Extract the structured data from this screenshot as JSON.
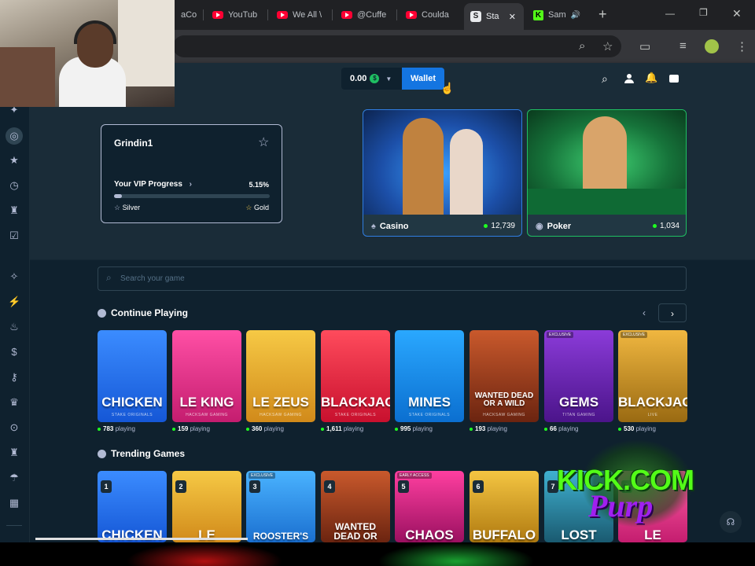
{
  "browser": {
    "tabs": [
      {
        "label": "aCo",
        "type": "plain"
      },
      {
        "label": "YouTub",
        "type": "youtube"
      },
      {
        "label": "We All \\",
        "type": "youtube"
      },
      {
        "label": "@Cuffe",
        "type": "youtube"
      },
      {
        "label": "Coulda",
        "type": "youtube"
      },
      {
        "label": "Sta",
        "type": "stake",
        "active": true
      },
      {
        "label": "Sam",
        "type": "kick"
      }
    ],
    "close_glyph": "✕",
    "new_tab_glyph": "+",
    "min_glyph": "—",
    "max_glyph": "❐",
    "win_close_glyph": "✕"
  },
  "header": {
    "balance": "0.00",
    "coin_symbol": "$",
    "wallet_label": "Wallet"
  },
  "vip": {
    "username": "Grindin1",
    "progress_label": "Your VIP Progress",
    "progress_percent": "5.15%",
    "progress_fraction": 0.0515,
    "current_tier": "Silver",
    "next_tier": "Gold"
  },
  "promos": [
    {
      "label": "Casino",
      "count": "12,739"
    },
    {
      "label": "Poker",
      "count": "1,034"
    }
  ],
  "search": {
    "placeholder": "Search your game"
  },
  "continue_playing": {
    "title": "Continue Playing",
    "games": [
      {
        "name": "CHICKEN",
        "sub": "STAKE ORIGINALS",
        "playing": "783",
        "badge": ""
      },
      {
        "name": "LE KING",
        "sub": "HACKSAW GAMING",
        "playing": "159",
        "badge": ""
      },
      {
        "name": "LE ZEUS",
        "sub": "HACKSAW GAMING",
        "playing": "360",
        "badge": ""
      },
      {
        "name": "BLACKJACK",
        "sub": "STAKE ORIGINALS",
        "playing": "1,611",
        "badge": ""
      },
      {
        "name": "MINES",
        "sub": "STAKE ORIGINALS",
        "playing": "995",
        "badge": ""
      },
      {
        "name": "WANTED DEAD OR A WILD",
        "sub": "HACKSAW GAMING",
        "playing": "193",
        "badge": ""
      },
      {
        "name": "GEMS",
        "sub": "TITAN GAMING",
        "playing": "66",
        "badge": "EXCLUSIVE"
      },
      {
        "name": "BLACKJACK",
        "sub": "LIVE",
        "playing": "530",
        "badge": "EXCLUSIVE"
      }
    ],
    "playing_suffix": "playing"
  },
  "trending": {
    "title": "Trending Games",
    "games": [
      {
        "rank": "1",
        "name": "CHICKEN",
        "badge": ""
      },
      {
        "rank": "2",
        "name": "LE",
        "badge": ""
      },
      {
        "rank": "3",
        "name": "ROOSTER'S",
        "badge": "EXCLUSIVE"
      },
      {
        "rank": "4",
        "name": "WANTED DEAD OR",
        "badge": ""
      },
      {
        "rank": "5",
        "name": "CHAOS",
        "badge": "EARLY ACCESS"
      },
      {
        "rank": "6",
        "name": "BUFFALO",
        "badge": ""
      },
      {
        "rank": "7",
        "name": "LOST",
        "badge": ""
      },
      {
        "rank": "8",
        "name": "LE",
        "badge": ""
      }
    ]
  },
  "overlay": {
    "kick_text": "KICK.COM",
    "purp_text": "Purp"
  },
  "colors": {
    "bg": "#0f212e",
    "panel": "#1a2c38",
    "wallet_blue": "#1475e1",
    "online_green": "#1fff20"
  }
}
